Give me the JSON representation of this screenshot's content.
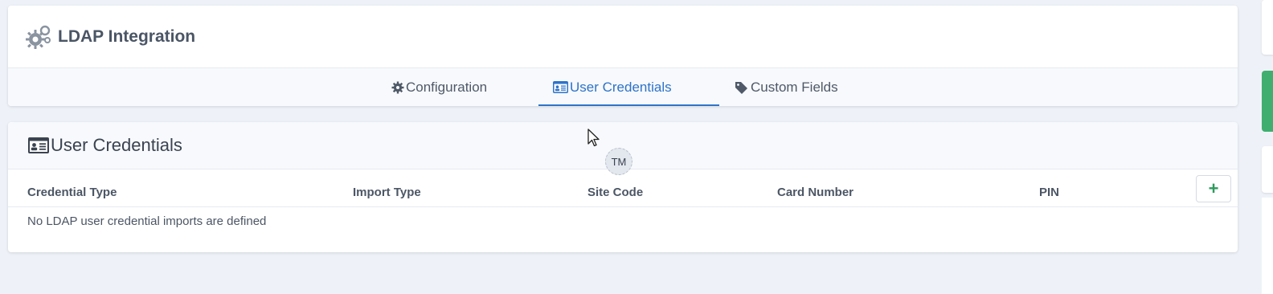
{
  "header": {
    "title": "LDAP Integration",
    "icon": "gears-icon"
  },
  "tabs": [
    {
      "label": "Configuration",
      "icon": "gear-icon",
      "active": false
    },
    {
      "label": "User Credentials",
      "icon": "id-card-icon",
      "active": true
    },
    {
      "label": "Custom Fields",
      "icon": "tag-icon",
      "active": false
    }
  ],
  "section": {
    "title": "User Credentials",
    "icon": "id-card-icon"
  },
  "table": {
    "columns": [
      "Credential Type",
      "Import Type",
      "Site Code",
      "Card Number",
      "PIN"
    ],
    "empty_message": "No LDAP user credential imports are defined",
    "add_label": "+"
  },
  "avatar": {
    "initials": "TM"
  },
  "colors": {
    "accent": "#2e73c8",
    "add": "#2e9a5c",
    "status_green": "#3fae6e"
  }
}
